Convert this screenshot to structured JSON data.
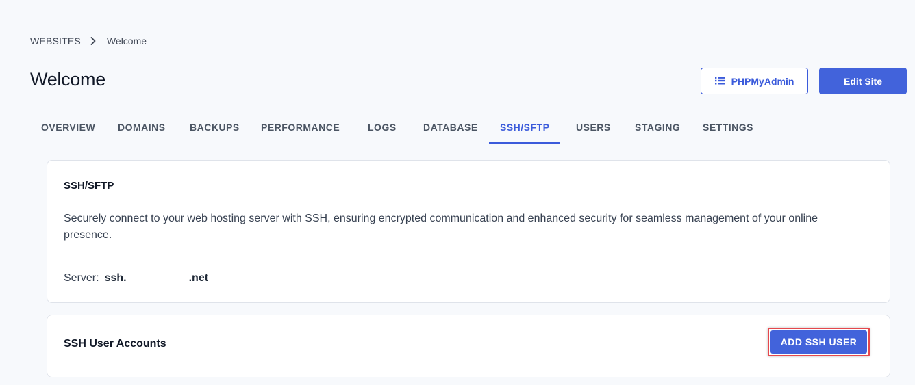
{
  "breadcrumb": {
    "parent": "WEBSITES",
    "current": "Welcome"
  },
  "page": {
    "title": "Welcome"
  },
  "header_actions": {
    "phpmyadmin_label": "PHPMyAdmin",
    "edit_site_label": "Edit Site"
  },
  "tabs": [
    {
      "label": "OVERVIEW"
    },
    {
      "label": "DOMAINS"
    },
    {
      "label": "BACKUPS"
    },
    {
      "label": "PERFORMANCE"
    },
    {
      "label": "LOGS"
    },
    {
      "label": "DATABASE"
    },
    {
      "label": "SSH/SFTP",
      "active": true
    },
    {
      "label": "USERS"
    },
    {
      "label": "STAGING"
    },
    {
      "label": "SETTINGS"
    }
  ],
  "ssh_card": {
    "title": "SSH/SFTP",
    "description": "Securely connect to your web hosting server with SSH, ensuring encrypted communication and enhanced security for seamless management of your online presence.",
    "server_label": "Server:",
    "server_prefix": "ssh.",
    "server_suffix": ".net"
  },
  "users_card": {
    "title": "SSH User Accounts",
    "add_button_label": "ADD SSH USER"
  },
  "colors": {
    "accent": "#3b5bdb",
    "primary_button": "#4263db",
    "highlight": "#e5484d"
  },
  "icons": {
    "breadcrumb_separator": "chevron-right-icon",
    "phpmyadmin": "list-icon"
  }
}
